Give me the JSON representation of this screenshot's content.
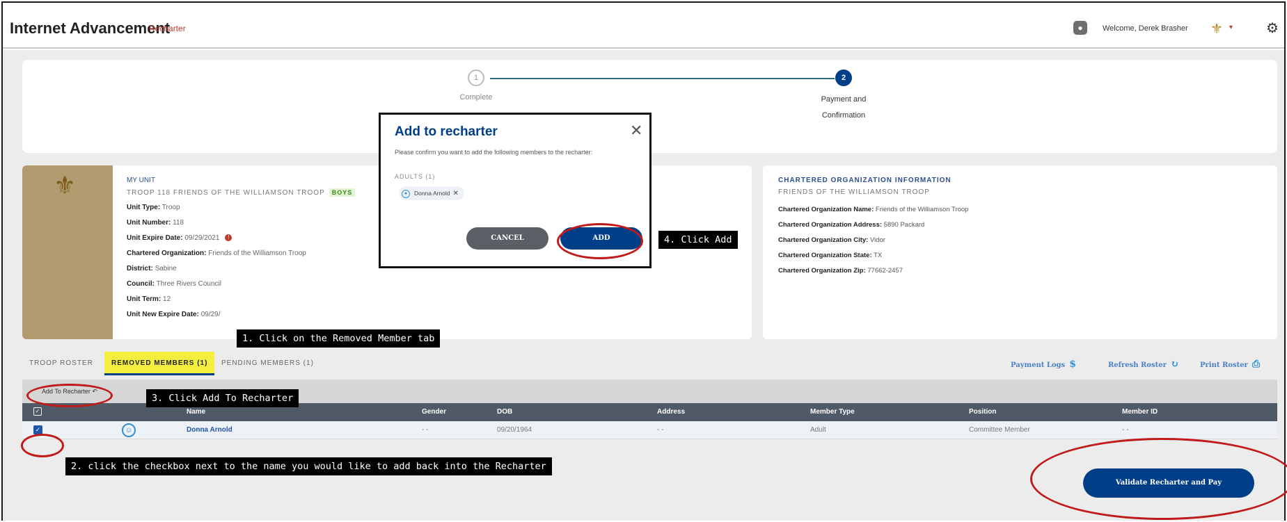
{
  "header": {
    "app_title": "Internet Advancement",
    "app_subtitle": "Recharter",
    "welcome": "Welcome, Derek Brasher"
  },
  "stepper": {
    "steps": [
      {
        "number": "1",
        "label": "Complete"
      },
      {
        "number": "2",
        "label_line1": "Payment and",
        "label_line2": "Confirmation"
      }
    ]
  },
  "unit": {
    "heading": "MY UNIT",
    "troop_name": "TROOP 118 FRIENDS OF THE WILLIAMSON TROOP",
    "badge": "BOYS",
    "rows": [
      {
        "label": "Unit Type:",
        "value": "Troop"
      },
      {
        "label": "Unit Number:",
        "value": "118"
      },
      {
        "label": "Unit Expire Date:",
        "value": "09/29/2021"
      },
      {
        "label": "Chartered Organization:",
        "value": "Friends of the Williamson Troop"
      },
      {
        "label": "District:",
        "value": "Sabine"
      },
      {
        "label": "Council:",
        "value": "Three Rivers Council"
      },
      {
        "label": "Unit Term:",
        "value": "12"
      },
      {
        "label": "Unit New Expire Date:",
        "value": "09/29/"
      }
    ]
  },
  "org": {
    "heading": "CHARTERED ORGANIZATION INFORMATION",
    "sub": "FRIENDS OF THE WILLIAMSON TROOP",
    "rows": [
      {
        "label": "Chartered Organization Name:",
        "value": "Friends of the Williamson Troop"
      },
      {
        "label": "Chartered Organization Address:",
        "value": "5890 Packard"
      },
      {
        "label": "Chartered Organization City:",
        "value": "Vidor"
      },
      {
        "label": "Chartered Organization State:",
        "value": "TX"
      },
      {
        "label": "Chartered Organization Zip:",
        "value": "77662-2457"
      }
    ]
  },
  "tabs": {
    "roster": "TROOP ROSTER",
    "removed": "REMOVED MEMBERS (1)",
    "pending": "PENDING MEMBERS (1)"
  },
  "actions": {
    "payment_logs": "Payment Logs",
    "refresh_roster": "Refresh Roster",
    "print_roster": "Print Roster"
  },
  "toolbar": {
    "add_to_recharter": "Add To Recharter"
  },
  "table": {
    "headers": [
      "Name",
      "Gender",
      "DOB",
      "Address",
      "Member Type",
      "Position",
      "Member ID"
    ],
    "rows": [
      {
        "name": "Donna Arnold",
        "gender": "- -",
        "dob": "09/20/1964",
        "address": "- -",
        "member_type": "Adult",
        "position": "Committee Member",
        "member_id": "- -",
        "checked": true
      }
    ]
  },
  "validate_button": "Validate Recharter and Pay",
  "modal": {
    "title": "Add to recharter",
    "text": "Please confirm you want to add the following members to the recharter:",
    "adults_label": "ADULTS (1)",
    "chip_name": "Donna Arnold",
    "cancel": "CANCEL",
    "add": "ADD"
  },
  "callouts": {
    "step1": "1. Click on the Removed Member tab",
    "step2": "2. click the checkbox next to the name you would like to add back into the Recharter",
    "step3": "3. Click Add To Recharter",
    "step4": "4. Click Add"
  },
  "colors": {
    "brand_blue": "#003f87",
    "tab_highlight": "#f4ef3e",
    "annotation_red": "#c01a1a",
    "unit_tan": "#b39b70"
  },
  "icons": [
    "user-icon",
    "fleur-de-lis-icon",
    "gear-icon",
    "dollar-icon",
    "refresh-icon",
    "print-icon",
    "undo-icon",
    "close-icon",
    "person-icon",
    "checkbox-icon"
  ]
}
